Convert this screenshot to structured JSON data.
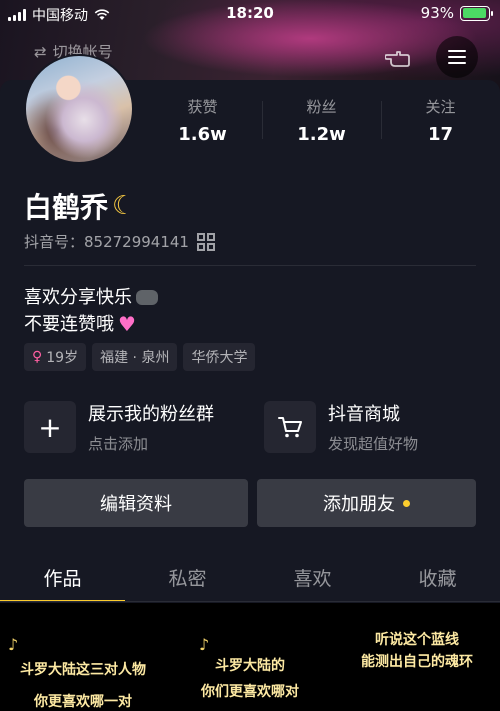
{
  "status_bar": {
    "carrier": "中国移动",
    "time": "18:20",
    "battery": "93%",
    "battery_level": 0.93
  },
  "top": {
    "switch_account": "切换帐号"
  },
  "profile": {
    "stats": [
      {
        "label": "获赞",
        "value": "1.6w"
      },
      {
        "label": "粉丝",
        "value": "1.2w"
      },
      {
        "label": "关注",
        "value": "17"
      }
    ],
    "nickname": "白鹤乔",
    "douyin_id": "抖音号：85272994141",
    "bio_line1": "喜欢分享快乐",
    "bio_line2": "不要连赞哦",
    "tags": {
      "age": "19岁",
      "location": "福建 · 泉州",
      "school": "华侨大学"
    }
  },
  "features": [
    {
      "title": "展示我的粉丝群",
      "subtitle": "点击添加",
      "icon": "plus-icon"
    },
    {
      "title": "抖音商城",
      "subtitle": "发现超值好物",
      "icon": "cart-icon"
    }
  ],
  "actions": {
    "edit": "编辑资料",
    "add_friend": "添加朋友"
  },
  "tabs": [
    "作品",
    "私密",
    "喜欢",
    "收藏"
  ],
  "videos": [
    {
      "line1": "斗罗大陆这三对人物",
      "line2": "你更喜欢哪一对"
    },
    {
      "line1": "斗罗大陆的",
      "line2": "你们更喜欢哪对"
    },
    {
      "line1": "听说这个蓝线",
      "line2": "能测出自己的魂环"
    }
  ],
  "colors": {
    "background": "#161823",
    "accent": "#fccd2e",
    "button": "#393b44"
  }
}
